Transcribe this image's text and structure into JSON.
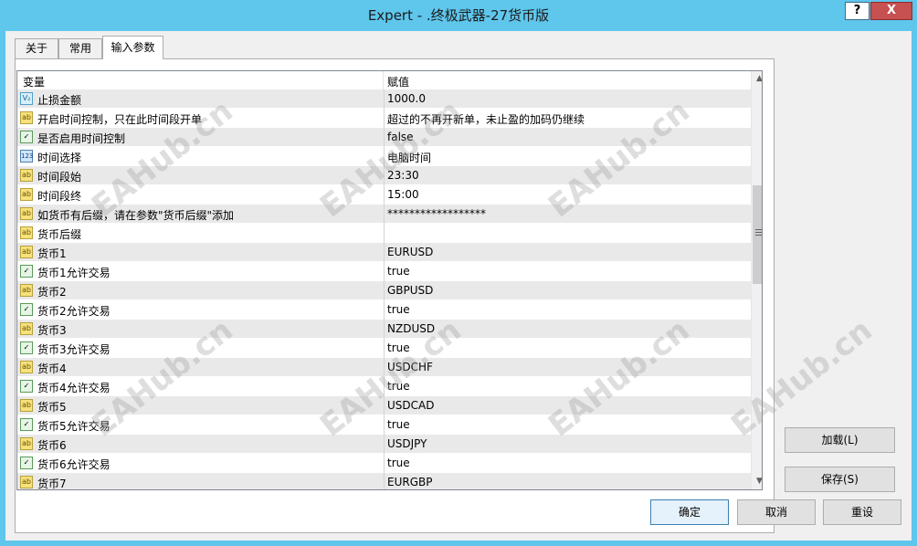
{
  "window": {
    "title": "Expert - .终极武器-27货币版",
    "help_label": "?",
    "close_label": "X"
  },
  "tabs": [
    {
      "label": "关于"
    },
    {
      "label": "常用"
    },
    {
      "label": "输入参数"
    }
  ],
  "grid": {
    "headers": {
      "variable": "变量",
      "value": "赋值"
    },
    "rows": [
      {
        "icon": "double-icon",
        "glyph": "V₂",
        "name": "止损金额",
        "value": "1000.0"
      },
      {
        "icon": "string-icon",
        "glyph": "ab",
        "name": "开启时间控制，只在此时间段开单",
        "value": "超过的不再开新单，未止盈的加码仍继续"
      },
      {
        "icon": "bool-icon",
        "glyph": "✓",
        "name": "是否启用时间控制",
        "value": "false"
      },
      {
        "icon": "enum-icon",
        "glyph": "123",
        "name": "时间选择",
        "value": "电脑时间"
      },
      {
        "icon": "string-icon",
        "glyph": "ab",
        "name": "时间段始",
        "value": "23:30"
      },
      {
        "icon": "string-icon",
        "glyph": "ab",
        "name": "时间段终",
        "value": "15:00"
      },
      {
        "icon": "string-icon",
        "glyph": "ab",
        "name": "如货币有后缀，请在参数\"货币后缀\"添加",
        "value": "******************"
      },
      {
        "icon": "string-icon",
        "glyph": "ab",
        "name": "货币后缀",
        "value": ""
      },
      {
        "icon": "string-icon",
        "glyph": "ab",
        "name": "货币1",
        "value": "EURUSD"
      },
      {
        "icon": "bool-icon",
        "glyph": "✓",
        "name": "货币1允许交易",
        "value": "true"
      },
      {
        "icon": "string-icon",
        "glyph": "ab",
        "name": "货币2",
        "value": "GBPUSD"
      },
      {
        "icon": "bool-icon",
        "glyph": "✓",
        "name": "货币2允许交易",
        "value": "true"
      },
      {
        "icon": "string-icon",
        "glyph": "ab",
        "name": "货币3",
        "value": "NZDUSD"
      },
      {
        "icon": "bool-icon",
        "glyph": "✓",
        "name": "货币3允许交易",
        "value": "true"
      },
      {
        "icon": "string-icon",
        "glyph": "ab",
        "name": "货币4",
        "value": "USDCHF"
      },
      {
        "icon": "bool-icon",
        "glyph": "✓",
        "name": "货币4允许交易",
        "value": "true"
      },
      {
        "icon": "string-icon",
        "glyph": "ab",
        "name": "货币5",
        "value": "USDCAD"
      },
      {
        "icon": "bool-icon",
        "glyph": "✓",
        "name": "货币5允许交易",
        "value": "true"
      },
      {
        "icon": "string-icon",
        "glyph": "ab",
        "name": "货币6",
        "value": "USDJPY"
      },
      {
        "icon": "bool-icon",
        "glyph": "✓",
        "name": "货币6允许交易",
        "value": "true"
      },
      {
        "icon": "string-icon",
        "glyph": "ab",
        "name": "货币7",
        "value": "EURGBP"
      }
    ]
  },
  "buttons": {
    "load": "加载(L)",
    "save": "保存(S)",
    "ok": "确定",
    "cancel": "取消",
    "reset": "重设"
  },
  "watermark": "EAHub.cn",
  "colors": {
    "title_bar": "#5fc6ec",
    "close_button": "#c75050",
    "row_alt": "#e9e9e9"
  }
}
